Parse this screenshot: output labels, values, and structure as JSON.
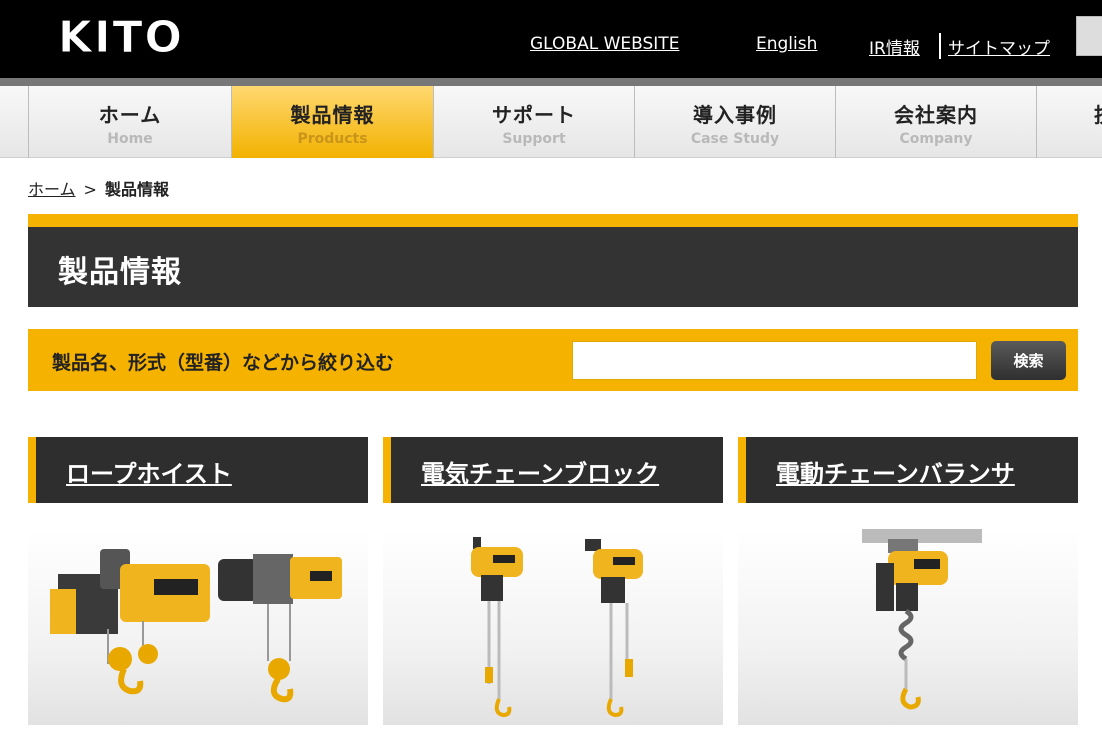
{
  "header": {
    "logo_text": "KITO",
    "links": [
      "GLOBAL WEBSITE",
      "English",
      "IR情報",
      "サイトマップ"
    ]
  },
  "nav": [
    {
      "jp": "ホーム",
      "en": "Home",
      "active": false
    },
    {
      "jp": "製品情報",
      "en": "Products",
      "active": true
    },
    {
      "jp": "サポート",
      "en": "Support",
      "active": false
    },
    {
      "jp": "導入事例",
      "en": "Case Study",
      "active": false
    },
    {
      "jp": "会社案内",
      "en": "Company",
      "active": false
    },
    {
      "jp": "技",
      "en": "",
      "active": false
    }
  ],
  "breadcrumb": {
    "home": "ホーム",
    "separator": ">",
    "current": "製品情報"
  },
  "page": {
    "title": "製品情報"
  },
  "filter": {
    "label": "製品名、形式（型番）などから絞り込む",
    "input_value": "",
    "button_label": "検索"
  },
  "products": [
    {
      "title": "ロープホイスト",
      "image_icon": "rope-hoist-icon"
    },
    {
      "title": "電気チェーンブロック",
      "image_icon": "electric-chain-hoist-icon"
    },
    {
      "title": "電動チェーンバランサ",
      "image_icon": "chain-balancer-icon"
    }
  ],
  "colors": {
    "accent": "#f5b300",
    "header_bg": "#000000",
    "band_bg": "#333333"
  }
}
